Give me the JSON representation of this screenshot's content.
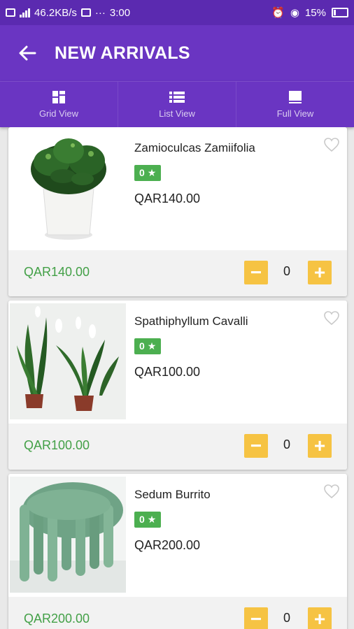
{
  "status_bar": {
    "network_speed": "46.2KB/s",
    "time": "3:00",
    "battery": "15%",
    "dots": "···"
  },
  "app_bar": {
    "title": "NEW ARRIVALS"
  },
  "view_tabs": [
    {
      "label": "Grid View",
      "icon": "grid-icon"
    },
    {
      "label": "List View",
      "icon": "list-icon"
    },
    {
      "label": "Full View",
      "icon": "full-view-icon"
    }
  ],
  "products": [
    {
      "name": "Zamioculcas Zamiifolia",
      "rating": "0",
      "price": "QAR140.00",
      "footer_price": "QAR140.00",
      "quantity": "0",
      "image": "plant-zz-white-pot"
    },
    {
      "name": "Spathiphyllum Cavalli",
      "rating": "0",
      "price": "QAR100.00",
      "footer_price": "QAR100.00",
      "quantity": "0",
      "image": "peace-lily-plants"
    },
    {
      "name": "Sedum Burrito",
      "rating": "0",
      "price": "QAR200.00",
      "footer_price": "QAR200.00",
      "quantity": "0",
      "image": "sedum-burrito-plant"
    }
  ],
  "colors": {
    "purple": "#6a35c2",
    "status_purple": "#5b2ab0",
    "green": "#4caf50",
    "price_green": "#43a047",
    "yellow": "#f6c343"
  }
}
